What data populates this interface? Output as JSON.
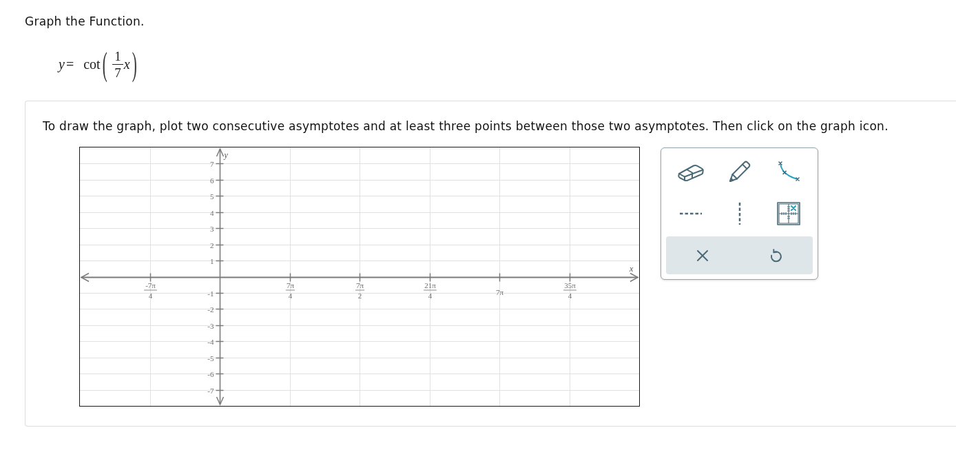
{
  "prompt": {
    "title": "Graph the Function."
  },
  "equation": {
    "left": "y",
    "relation": "=",
    "function": "cot",
    "open": "(",
    "numerator": "1",
    "denominator": "7",
    "variable": "x",
    "close": ")"
  },
  "card": {
    "instructions": "To draw the graph, plot two consecutive asymptotes and at least three points between those two asymptotes. Then click on the graph icon.",
    "graph": {
      "x_label": "x",
      "y_label": "y",
      "x_ticks_negative": [
        {
          "kind": "fraction",
          "numerator": "-7π",
          "denominator": "4"
        }
      ],
      "x_ticks_positive": [
        {
          "kind": "fraction",
          "numerator": "7π",
          "denominator": "4"
        },
        {
          "kind": "fraction",
          "numerator": "7π",
          "denominator": "2"
        },
        {
          "kind": "fraction",
          "numerator": "21π",
          "denominator": "4"
        },
        {
          "kind": "plain",
          "label": "7π"
        },
        {
          "kind": "fraction",
          "numerator": "35π",
          "denominator": "4"
        }
      ],
      "y_ticks_positive": [
        "7",
        "6",
        "5",
        "4",
        "3",
        "2",
        "1"
      ],
      "y_ticks_negative": [
        "-1",
        "-2",
        "-3",
        "-4",
        "-5",
        "-6",
        "-7"
      ]
    },
    "tools": [
      {
        "kind": "eraser"
      },
      {
        "kind": "pencil"
      },
      {
        "kind": "curve"
      },
      {
        "kind": "hline"
      },
      {
        "kind": "vline"
      },
      {
        "kind": "grid"
      }
    ],
    "actions": [
      {
        "kind": "close"
      },
      {
        "kind": "undo"
      }
    ]
  }
}
